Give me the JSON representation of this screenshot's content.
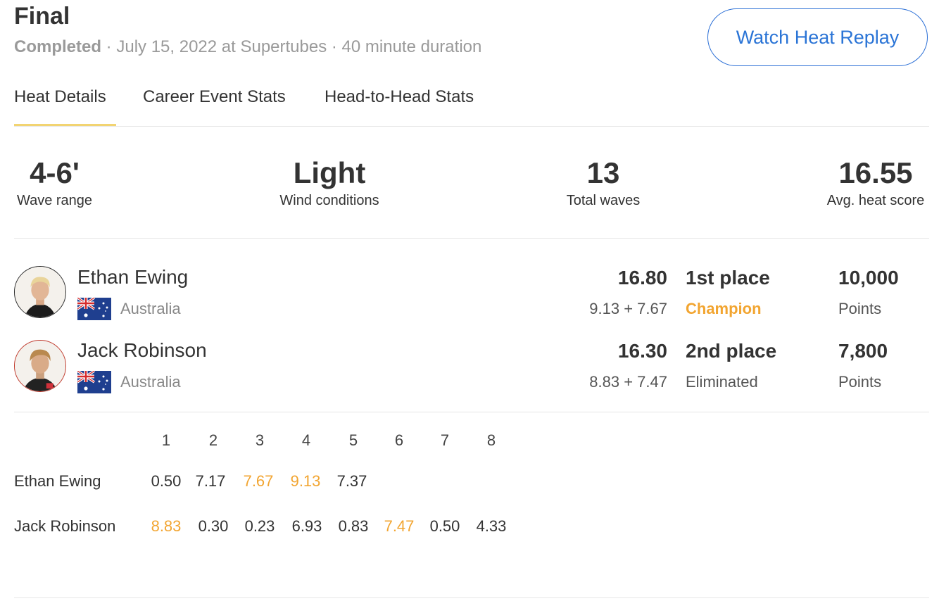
{
  "header": {
    "title": "Final",
    "status": "Completed",
    "meta_rest": " · July 15, 2022 at Supertubes · 40 minute duration",
    "replay_button": "Watch Heat Replay"
  },
  "tabs": [
    {
      "label": "Heat Details",
      "active": true
    },
    {
      "label": "Career Event Stats",
      "active": false
    },
    {
      "label": "Head-to-Head Stats",
      "active": false
    }
  ],
  "stats": [
    {
      "value": "4-6'",
      "label": "Wave range"
    },
    {
      "value": "Light",
      "label": "Wind conditions"
    },
    {
      "value": "13",
      "label": "Total waves"
    },
    {
      "value": "16.55",
      "label": "Avg. heat score"
    }
  ],
  "surfers": [
    {
      "name": "Ethan Ewing",
      "country": "Australia",
      "total": "16.80",
      "breakdown": "9.13 + 7.67",
      "place": "1st place",
      "result": "Champion",
      "points": "10,000",
      "points_label": "Points"
    },
    {
      "name": "Jack Robinson",
      "country": "Australia",
      "total": "16.30",
      "breakdown": "8.83 + 7.47",
      "place": "2nd place",
      "result": "Eliminated",
      "points": "7,800",
      "points_label": "Points"
    }
  ],
  "waves": {
    "headers": [
      "1",
      "2",
      "3",
      "4",
      "5",
      "6",
      "7",
      "8"
    ],
    "rows": [
      {
        "name": "Ethan Ewing",
        "scores": [
          "0.50",
          "7.17",
          "7.67",
          "9.13",
          "7.37"
        ],
        "counted": [
          false,
          false,
          true,
          true,
          false
        ]
      },
      {
        "name": "Jack Robinson",
        "scores": [
          "8.83",
          "0.30",
          "0.23",
          "6.93",
          "0.83",
          "7.47",
          "0.50",
          "4.33"
        ],
        "counted": [
          true,
          false,
          false,
          false,
          false,
          true,
          false,
          false
        ]
      }
    ]
  },
  "colors": {
    "accent_blue": "#2a74d6",
    "counted_orange": "#f2a531",
    "tab_underline": "#f2d472",
    "avatar_border_1": "#2b2b2b",
    "avatar_border_2": "#c0392b"
  }
}
